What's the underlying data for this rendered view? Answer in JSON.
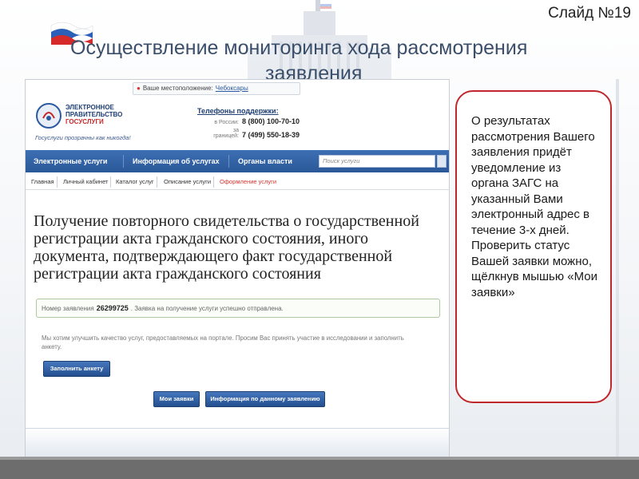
{
  "slide": {
    "number_label": "Слайд №19",
    "title_line1": "Осуществление мониторинга хода рассмотрения",
    "title_line2": "заявления"
  },
  "portal": {
    "location_label": "Ваше местоположение:",
    "location_city": "Чебоксары",
    "logo_line1": "ЭЛЕКТРОННОЕ",
    "logo_line2": "ПРАВИТЕЛЬСТВО",
    "logo_line3": "ГОСУСЛУГИ",
    "tagline": "Госуслуги прозрачны как никогда!",
    "support": {
      "title": "Телефоны поддержки:",
      "russia_label": "в России:",
      "russia_number": "8 (800) 100-70-10",
      "abroad_label": "за границей:",
      "abroad_number": "7 (499) 550-18-39"
    },
    "nav": {
      "items": [
        "Электронные услуги",
        "Информация об услугах",
        "Органы власти"
      ],
      "search_placeholder": "Поиск услуги"
    },
    "breadcrumbs": [
      "Главная",
      "Личный кабинет",
      "Каталог услуг",
      "Описание услуги",
      "Оформление услуги"
    ],
    "heading": "Получение повторного свидетельства о государственной регистрации акта гражданского состояния, иного документа, подтверждающего факт государственной регистрации акта гражданского состояния",
    "status": {
      "label": "Номер заявления",
      "number": "26299725",
      "message": ". Заявка на получение услуги успешно отправлена."
    },
    "survey_text": "Мы хотим улучшить качество услуг, предоставляемых на портале. Просим Вас принять участие в исследовании и заполнить анкету.",
    "buttons": {
      "fill_survey": "Заполнить анкету",
      "my_requests": "Мои заявки",
      "request_info": "Информация по данному заявлению"
    }
  },
  "callout": {
    "text": "О результатах рассмотрения Вашего заявления придёт уведомление из органа ЗАГС на указанный Вами электронный адрес в течение 3-х дней. Проверить статус Вашей заявки можно, щёлкнув мышью «Мои заявки»"
  },
  "colors": {
    "nav_blue": "#2a5898",
    "accent_red": "#c0272d",
    "title_blue": "#3b4f6b"
  }
}
